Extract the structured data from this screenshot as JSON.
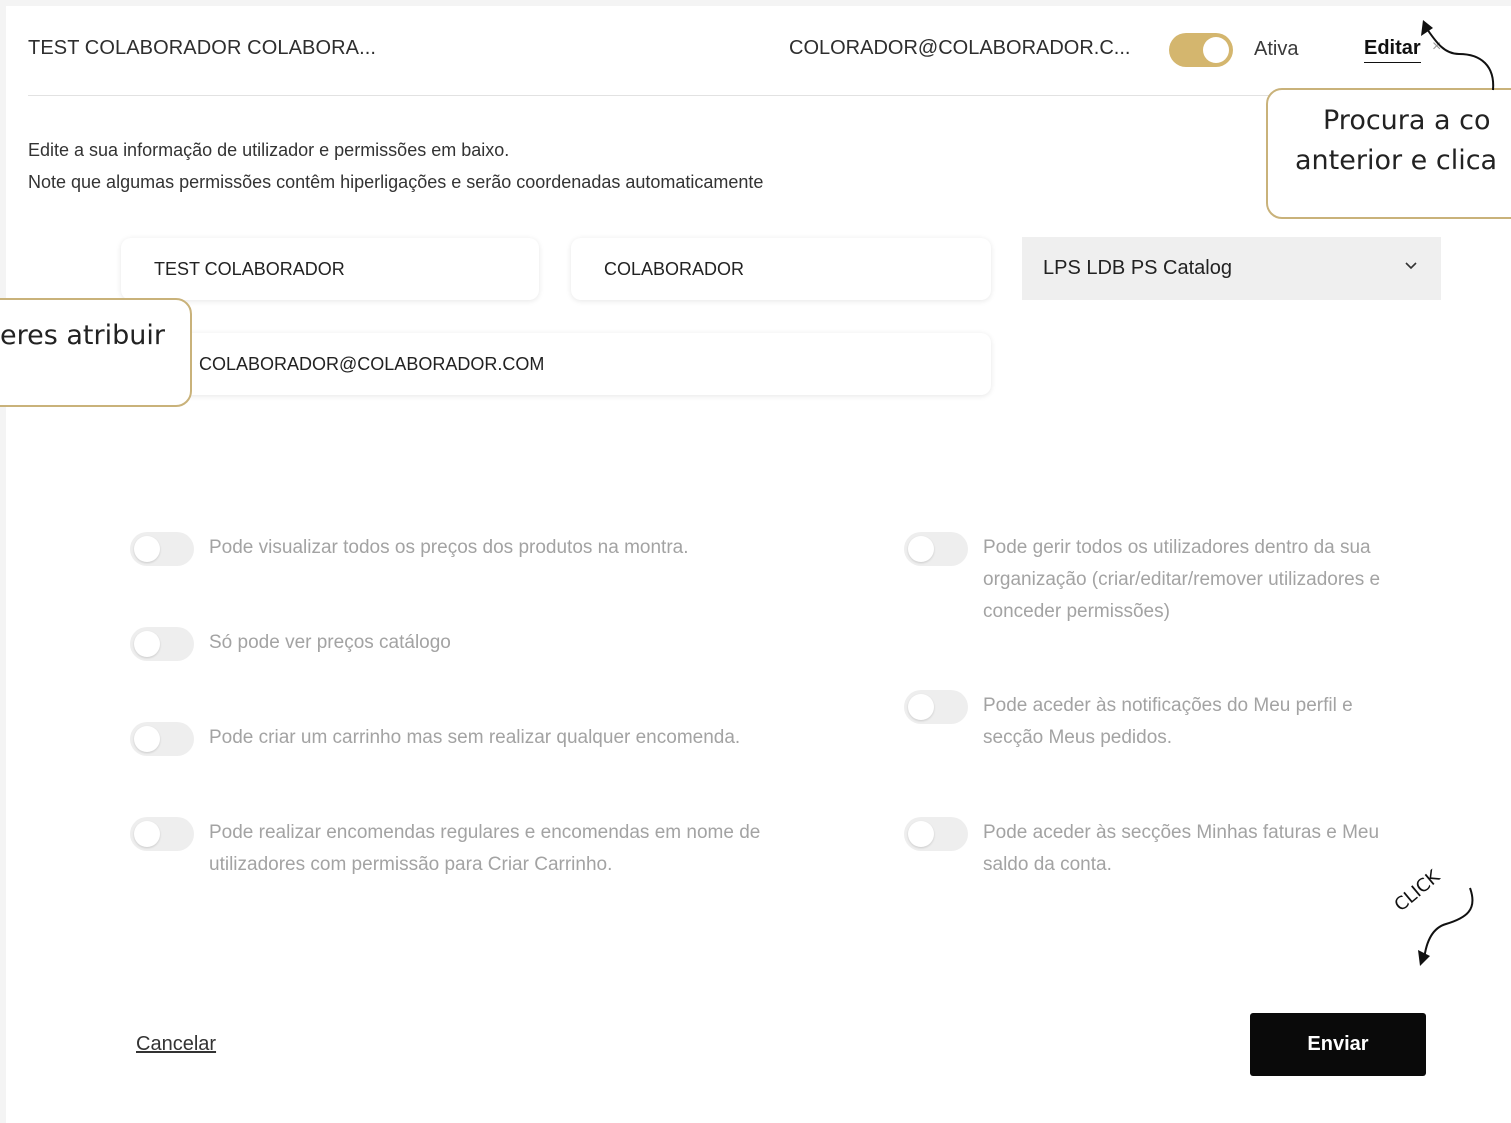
{
  "header": {
    "name": "TEST COLABORADOR COLABORA...",
    "email": "COLORADOR@COLABORADOR.C...",
    "status": "Ativa",
    "edit_label": "Editar",
    "close_glyph": "×",
    "trash_glyph": "🗑"
  },
  "description": {
    "line1": "Edite a sua informação de utilizador e permissões em baixo.",
    "line2": "Note que algumas permissões contêm hiperligações e serão coordenadas automaticamente"
  },
  "form": {
    "first_name": "TEST COLABORADOR",
    "last_name": "COLABORADOR",
    "email": "COLABORADOR@COLABORADOR.COM",
    "catalog": "LPS LDB PS Catalog"
  },
  "permissions": {
    "left": [
      "Pode visualizar todos os preços dos produtos na montra.",
      "Só pode ver preços catálogo",
      "Pode criar um carrinho mas sem realizar qualquer encomenda.",
      "Pode realizar encomendas regulares e encomendas em nome de utilizadores com permissão para Criar Carrinho."
    ],
    "right": [
      "Pode gerir todos os utilizadores dentro da sua organização (criar/editar/remover utilizadores e conceder permissões)",
      "Pode aceder às notificações do Meu perfil e secção Meus pedidos.",
      "Pode aceder às secções Minhas faturas e Meu saldo da conta."
    ]
  },
  "footer": {
    "cancel_label": "Cancelar",
    "send_label": "Enviar"
  },
  "annotations": {
    "right_line1": "Procura a co",
    "right_line2": "anterior e clica",
    "left_line1": "eres atribuir",
    "click_label": "CLICK"
  },
  "colors": {
    "accent": "#d4b66e",
    "callout_border": "#c9b27a",
    "button": "#0a0a0a"
  }
}
